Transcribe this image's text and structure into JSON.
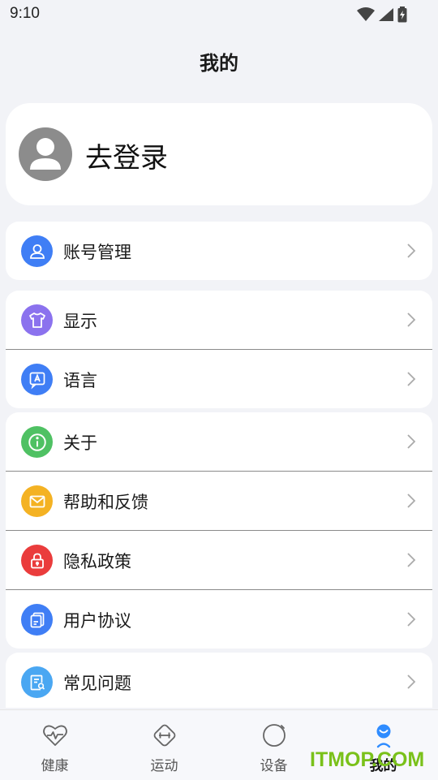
{
  "status_bar": {
    "time": "9:10"
  },
  "page_title": "我的",
  "profile": {
    "login_label": "去登录"
  },
  "groups": [
    {
      "items": [
        {
          "label": "账号管理",
          "icon": "person-icon",
          "color": "#3f7ef5"
        }
      ]
    },
    {
      "items": [
        {
          "label": "显示",
          "icon": "shirt-icon",
          "color": "#8b72ee"
        },
        {
          "label": "语言",
          "icon": "language-icon",
          "color": "#3f7ef5"
        }
      ]
    },
    {
      "items": [
        {
          "label": "关于",
          "icon": "info-icon",
          "color": "#4fc163"
        },
        {
          "label": "帮助和反馈",
          "icon": "mail-icon",
          "color": "#f4b223"
        },
        {
          "label": "隐私政策",
          "icon": "lock-icon",
          "color": "#ea3c3c"
        },
        {
          "label": "用户协议",
          "icon": "document-icon",
          "color": "#3f7ef5"
        }
      ]
    },
    {
      "items": [
        {
          "label": "常见问题",
          "icon": "faq-icon",
          "color": "#4aa7f2"
        }
      ]
    }
  ],
  "tabs": [
    {
      "label": "健康",
      "icon": "heart-icon",
      "active": false
    },
    {
      "label": "运动",
      "icon": "dumbbell-icon",
      "active": false
    },
    {
      "label": "设备",
      "icon": "watch-icon",
      "active": false
    },
    {
      "label": "我的",
      "icon": "smile-icon",
      "active": true,
      "accent": "#2f8cff"
    }
  ],
  "watermark": "ITMOP.COM"
}
